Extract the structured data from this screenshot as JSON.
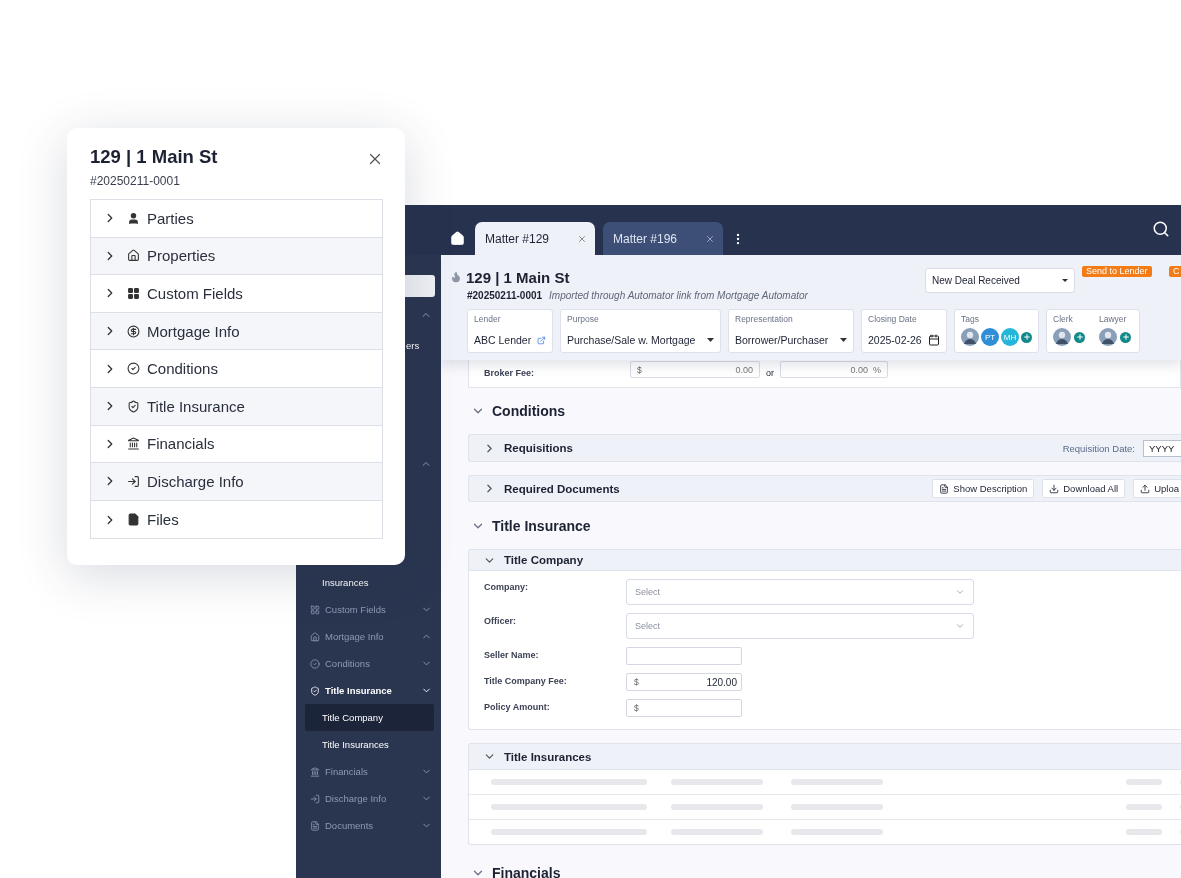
{
  "popup": {
    "title": "129 | 1 Main St",
    "number": "#20250211-0001",
    "sections": [
      {
        "label": "Parties",
        "expanded": false
      },
      {
        "label": "Properties",
        "expanded": false
      },
      {
        "label": "Custom Fields",
        "expanded": false
      },
      {
        "label": "Mortgage Info",
        "expanded": false
      },
      {
        "label": "Conditions",
        "expanded": false
      },
      {
        "label": "Title Insurance",
        "expanded": false
      },
      {
        "label": "Financials",
        "expanded": false
      },
      {
        "label": "Discharge Info",
        "expanded": false
      },
      {
        "label": "Files",
        "expanded": false
      }
    ]
  },
  "tabs": [
    {
      "label": "Matter #129",
      "selected": true
    },
    {
      "label": "Matter #196",
      "selected": false
    }
  ],
  "sidebar": {
    "upper": [
      {
        "kind": "search"
      },
      {
        "kind": "header",
        "expanded": true
      },
      {
        "kind": "sub",
        "label": "ers",
        "selected": false
      },
      {
        "kind": "header",
        "expanded": true
      }
    ],
    "items": [
      {
        "kind": "sub",
        "label": "Insurances",
        "selected": false
      },
      {
        "kind": "section",
        "label": "Custom Fields",
        "expanded": false,
        "active": false
      },
      {
        "kind": "section",
        "label": "Mortgage Info",
        "expanded": true,
        "active": false
      },
      {
        "kind": "section",
        "label": "Conditions",
        "expanded": false,
        "active": false
      },
      {
        "kind": "section",
        "label": "Title Insurance",
        "expanded": false,
        "active": true
      },
      {
        "kind": "sub",
        "label": "Title Company",
        "selected": true
      },
      {
        "kind": "sub",
        "label": "Title Insurances",
        "selected": false
      },
      {
        "kind": "section",
        "label": "Financials",
        "expanded": false,
        "active": false
      },
      {
        "kind": "section",
        "label": "Discharge Info",
        "expanded": false,
        "active": false
      },
      {
        "kind": "section",
        "label": "Documents",
        "expanded": false,
        "active": false
      }
    ]
  },
  "header": {
    "title": "129 | 1 Main St",
    "number": "#20250211-0001",
    "note": "Imported through Automator link from Mortgage Automator",
    "status": "New Deal Received",
    "badges": [
      "Send to Lender",
      "C"
    ],
    "fields": [
      {
        "kind": "link",
        "label": "Lender",
        "value": "ABC Lender"
      },
      {
        "kind": "select",
        "label": "Purpose",
        "value": "Purchase/Sale w. Mortgage"
      },
      {
        "kind": "select",
        "label": "Representation",
        "value": "Borrower/Purchaser"
      },
      {
        "kind": "date",
        "label": "Closing Date",
        "value": "2025-02-26"
      },
      {
        "kind": "people",
        "label": "Tags",
        "people": [
          {
            "kind": "photo"
          },
          {
            "kind": "initials",
            "initials": "PT",
            "color": "#2f8ed6"
          },
          {
            "kind": "initials",
            "initials": "MH",
            "color": "#25b6d9"
          }
        ]
      },
      {
        "kind": "staff",
        "roles": [
          {
            "label": "Clerk"
          },
          {
            "label": "Lawyer"
          }
        ]
      }
    ]
  },
  "broker_fee": {
    "label": "Broker Fee:",
    "currency": "$",
    "amount": "0.00",
    "separator": "or",
    "percent": "0.00",
    "percent_sign": "%"
  },
  "content": [
    {
      "kind": "heading",
      "label": "Conditions",
      "expanded": true
    },
    {
      "kind": "requisitions",
      "label": "Requisitions",
      "expanded": false,
      "date_label": "Requisition Date:",
      "date_placeholder": "YYYY"
    },
    {
      "kind": "documents",
      "label": "Required Documents",
      "expanded": false,
      "buttons": [
        "Show Description",
        "Download All",
        "Uploa"
      ]
    },
    {
      "kind": "heading",
      "label": "Title Insurance",
      "expanded": true
    },
    {
      "kind": "form",
      "label": "Title Company",
      "expanded": true,
      "rows": [
        {
          "kind": "select",
          "label": "Company:",
          "placeholder": "Select"
        },
        {
          "kind": "select",
          "label": "Officer:",
          "placeholder": "Select"
        },
        {
          "kind": "text",
          "label": "Seller Name:"
        },
        {
          "kind": "money",
          "label": "Title Company Fee:",
          "prefix": "$",
          "value": "120.00"
        },
        {
          "kind": "money",
          "label": "Policy Amount:",
          "prefix": "$"
        }
      ]
    },
    {
      "kind": "table",
      "label": "Title Insurances",
      "expanded": true,
      "rows": [
        {
          "loading": true
        },
        {
          "loading": true
        },
        {
          "loading": true
        }
      ]
    },
    {
      "kind": "heading",
      "label": "Financials",
      "expanded": true
    }
  ]
}
